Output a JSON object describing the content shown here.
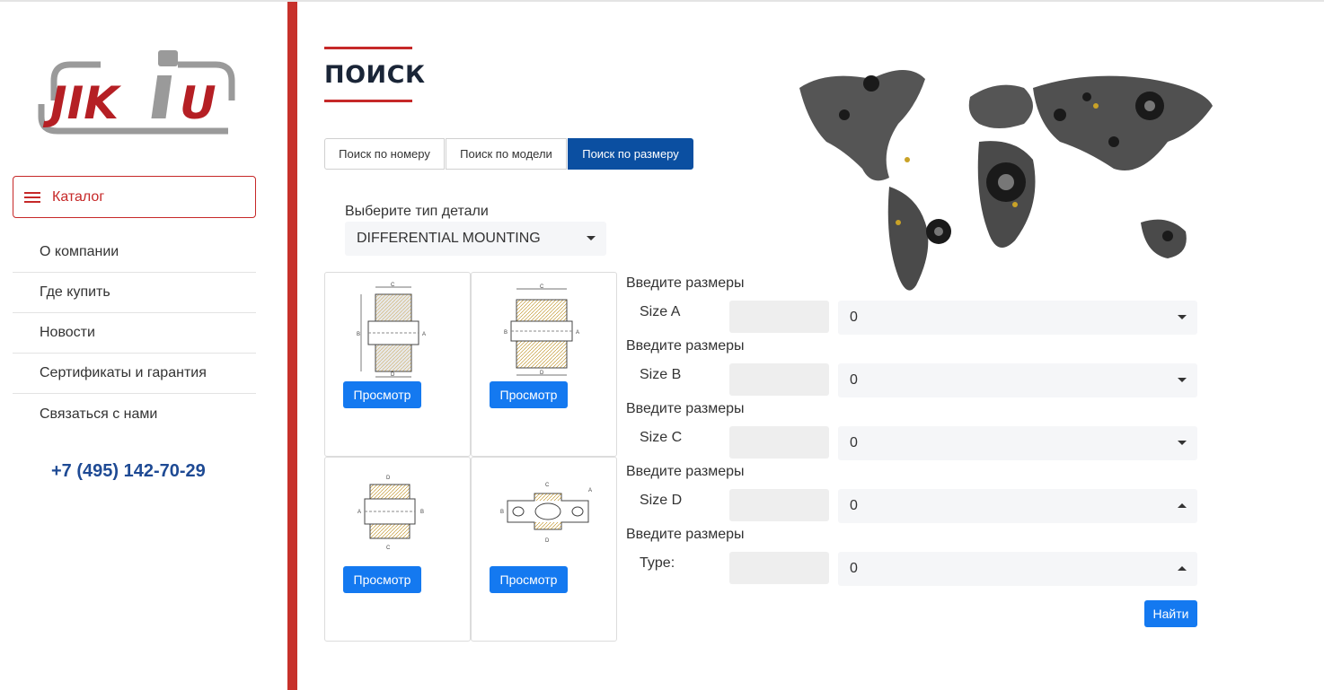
{
  "brand": {
    "logo_text": "JIKIU",
    "red": "#c62828",
    "blue": "#0b4fa1"
  },
  "sidebar": {
    "catalog_label": "Каталог",
    "items": [
      {
        "label": "О компании"
      },
      {
        "label": "Где купить"
      },
      {
        "label": "Новости"
      },
      {
        "label": "Сертификаты и гарантия"
      },
      {
        "label": "Связаться с нами"
      }
    ],
    "phone": "+7 (495) 142-70-29"
  },
  "main": {
    "title": "ПОИСК",
    "tabs": [
      {
        "label": "Поиск по номеру",
        "active": false
      },
      {
        "label": "Поиск по модели",
        "active": false
      },
      {
        "label": "Поиск по размеру",
        "active": true
      }
    ],
    "part_type_label": "Выберите тип детали",
    "part_type_value": "DIFFERENTIAL MOUNTING",
    "cards": [
      {
        "button": "Просмотр"
      },
      {
        "button": "Просмотр"
      },
      {
        "button": "Просмотр"
      },
      {
        "button": "Просмотр"
      }
    ],
    "sizes": [
      {
        "prompt": "Введите размеры",
        "name": "Size A",
        "value": "0",
        "caret": "down"
      },
      {
        "prompt": "Введите размеры",
        "name": "Size B",
        "value": "0",
        "caret": "down"
      },
      {
        "prompt": "Введите размеры",
        "name": "Size C",
        "value": "0",
        "caret": "down"
      },
      {
        "prompt": "Введите размеры",
        "name": "Size D",
        "value": "0",
        "caret": "up"
      },
      {
        "prompt": "Введите размеры",
        "name": "Type:",
        "value": "0",
        "caret": "up"
      }
    ],
    "find_label": "Найти"
  }
}
